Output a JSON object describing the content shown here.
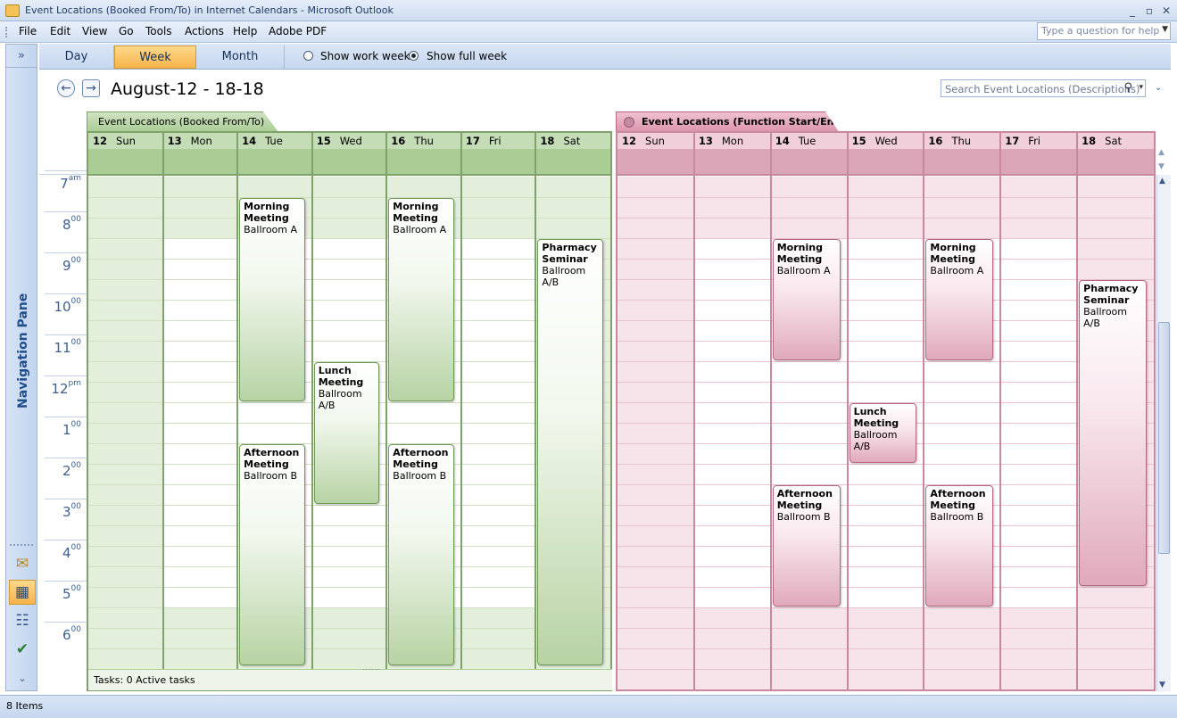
{
  "window": {
    "title": "Event Locations (Booked From/To) in Internet Calendars - Microsoft Outlook",
    "controls": {
      "minimize": "_",
      "restore": "▫",
      "close": "✕"
    }
  },
  "menu": {
    "items": [
      "File",
      "Edit",
      "View",
      "Go",
      "Tools",
      "Actions",
      "Help",
      "Adobe PDF"
    ],
    "help_placeholder": "Type a question for help"
  },
  "nav_pane": {
    "label": "Navigation Pane",
    "expand": "»",
    "buttons": [
      {
        "name": "mail-icon",
        "glyph": "✉"
      },
      {
        "name": "calendar-icon",
        "glyph": "▦"
      },
      {
        "name": "contacts-icon",
        "glyph": "☷"
      },
      {
        "name": "tasks-icon",
        "glyph": "✔"
      }
    ],
    "configure": "⌄"
  },
  "view_tabs": {
    "tabs": [
      "Day",
      "Week",
      "Month"
    ],
    "selected": "Week",
    "options": [
      "Show work week",
      "Show full week"
    ],
    "option_selected": "Show full week"
  },
  "header": {
    "back": "←",
    "forward": "→",
    "date_range": "August-12 - 18-18",
    "search_placeholder": "Search Event Locations (Descriptions)",
    "search_icon": "⚲",
    "dropdown": "▾",
    "chevron": "⌄"
  },
  "time_labels": [
    {
      "h": "7",
      "s": "am"
    },
    {
      "h": "8",
      "s": "00"
    },
    {
      "h": "9",
      "s": "00"
    },
    {
      "h": "10",
      "s": "00"
    },
    {
      "h": "11",
      "s": "00"
    },
    {
      "h": "12",
      "s": "pm"
    },
    {
      "h": "1",
      "s": "00"
    },
    {
      "h": "2",
      "s": "00"
    },
    {
      "h": "3",
      "s": "00"
    },
    {
      "h": "4",
      "s": "00"
    },
    {
      "h": "5",
      "s": "00"
    },
    {
      "h": "6",
      "s": "00"
    }
  ],
  "days": [
    {
      "num": "12",
      "name": "Sun"
    },
    {
      "num": "13",
      "name": "Mon"
    },
    {
      "num": "14",
      "name": "Tue"
    },
    {
      "num": "15",
      "name": "Wed"
    },
    {
      "num": "16",
      "name": "Thu"
    },
    {
      "num": "17",
      "name": "Fri"
    },
    {
      "num": "18",
      "name": "Sat"
    }
  ],
  "calendars": [
    {
      "id": "green",
      "tab": "Event Locations (Booked From/To)",
      "colors": {
        "header": "#c5ddb6",
        "allday": "#a9cd94",
        "nonwork": "#e3eedb",
        "line": "#7ea26a",
        "grid": "#cfe0c3"
      },
      "events": [
        {
          "day": 2,
          "start": 7,
          "end": 12,
          "title": "Morning Meeting",
          "location": "Ballroom A"
        },
        {
          "day": 4,
          "start": 7,
          "end": 12,
          "title": "Morning Meeting",
          "location": "Ballroom A"
        },
        {
          "day": 3,
          "start": 11,
          "end": 14.5,
          "title": "Lunch Meeting",
          "location": "Ballroom A/B"
        },
        {
          "day": 2,
          "start": 13,
          "end": 18.5,
          "title": "Afternoon Meeting",
          "location": "Ballroom B"
        },
        {
          "day": 4,
          "start": 13,
          "end": 18.5,
          "title": "Afternoon Meeting",
          "location": "Ballroom B"
        },
        {
          "day": 6,
          "start": 8,
          "end": 18.5,
          "title": "Pharmacy Seminar",
          "location": "Ballroom A/B"
        }
      ],
      "tasks": "Tasks: 0 Active tasks"
    },
    {
      "id": "pink",
      "tab": "Event Locations (Function Start/End))",
      "colors": {
        "header": "#f0cfda",
        "allday": "#dba6b8",
        "nonwork": "#f7e3ea",
        "line": "#c8889e",
        "grid": "#e9c3d0"
      },
      "events": [
        {
          "day": 2,
          "start": 8,
          "end": 11,
          "title": "Morning Meeting",
          "location": "Ballroom A"
        },
        {
          "day": 4,
          "start": 8,
          "end": 11,
          "title": "Morning Meeting",
          "location": "Ballroom A"
        },
        {
          "day": 3,
          "start": 12,
          "end": 13.5,
          "title": "Lunch Meeting",
          "location": "Ballroom A/B"
        },
        {
          "day": 2,
          "start": 14,
          "end": 17,
          "title": "Afternoon Meeting",
          "location": "Ballroom B"
        },
        {
          "day": 4,
          "start": 14,
          "end": 17,
          "title": "Afternoon Meeting",
          "location": "Ballroom B"
        },
        {
          "day": 6,
          "start": 9,
          "end": 16.5,
          "title": "Pharmacy Seminar",
          "location": "Ballroom A/B"
        }
      ]
    }
  ],
  "status": "8 Items"
}
